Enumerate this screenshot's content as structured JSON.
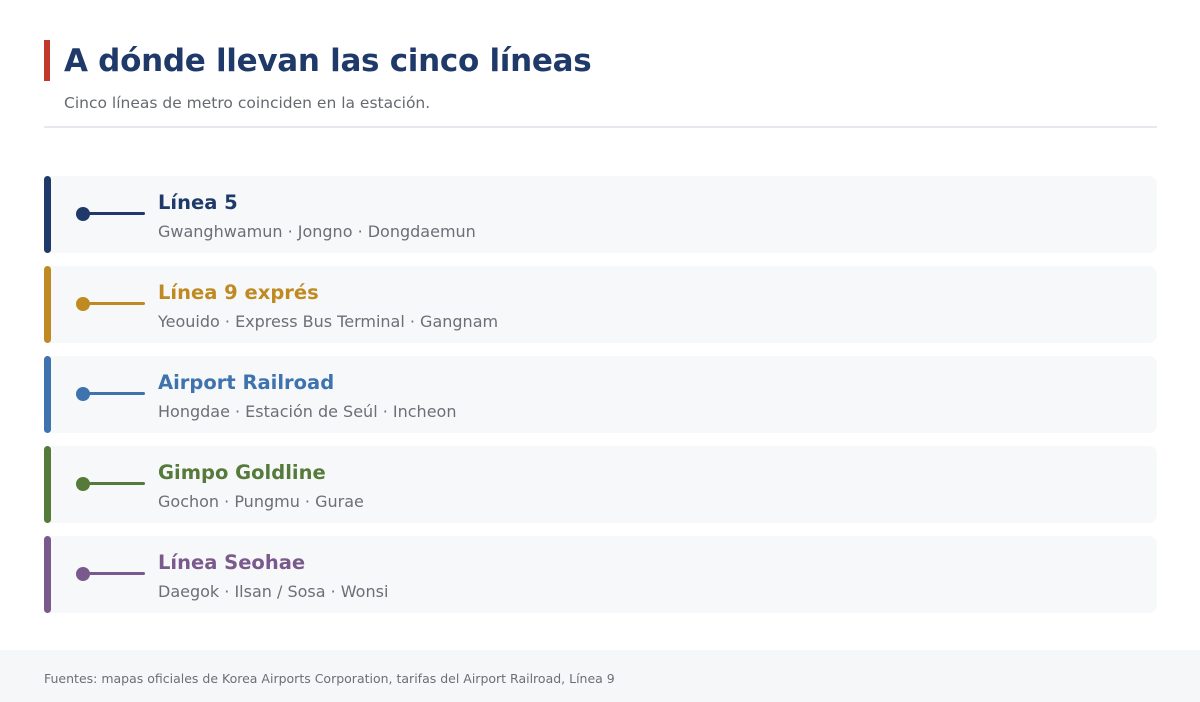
{
  "header": {
    "title": "A dónde llevan las cinco líneas",
    "subtitle": "Cinco líneas de metro coinciden en la estación."
  },
  "colors": {
    "title_accent": "#c0392b",
    "title_text": "#1f3a68"
  },
  "lines": [
    {
      "name": "Línea 5",
      "stops": "Gwanghwamun · Jongno · Dongdaemun",
      "color": "#1f3a68"
    },
    {
      "name": "Línea 9 exprés",
      "stops": "Yeouido · Express Bus Terminal · Gangnam",
      "color": "#c08a22"
    },
    {
      "name": "Airport Railroad",
      "stops": "Hongdae · Estación de Seúl · Incheon",
      "color": "#3f73ad"
    },
    {
      "name": "Gimpo Goldline",
      "stops": "Gochon · Pungmu · Gurae",
      "color": "#557a3a"
    },
    {
      "name": "Línea Seohae",
      "stops": "Daegok · Ilsan / Sosa · Wonsi",
      "color": "#7a5a8c"
    }
  ],
  "footer": {
    "sources": "Fuentes: mapas oficiales de Korea Airports Corporation, tarifas del Airport Railroad, Línea 9"
  }
}
